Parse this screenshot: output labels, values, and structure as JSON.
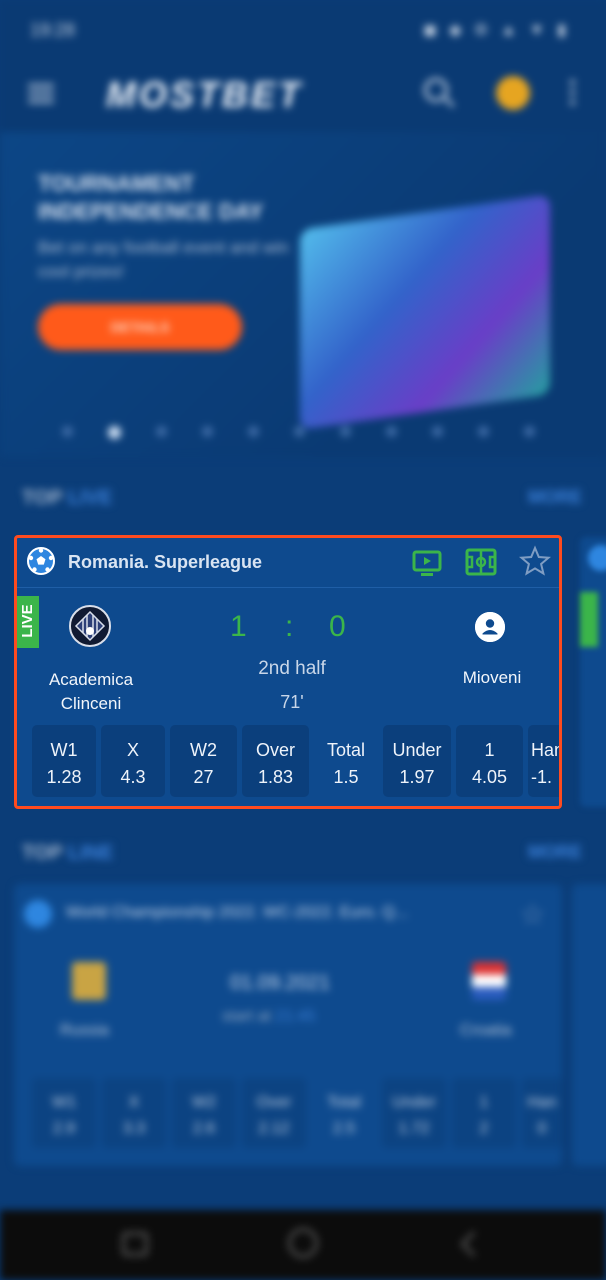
{
  "status_bar": {
    "time": "19:28",
    "icons": "◼ ◆ ⚙  ▲ ▼ ▮"
  },
  "app_bar": {
    "logo": "MOSTBET"
  },
  "banner": {
    "title": "TOURNAMENT INDEPENDENCE DAY",
    "subtitle": "Bet on any football event and win cool prizes!",
    "button": "DETAILS",
    "active_slide": 2,
    "slide_count": 11
  },
  "section1": {
    "title_a": "TOP",
    "title_b": "LIVE",
    "more": "MORE"
  },
  "section2": {
    "title_a": "TOP",
    "title_b": "LINE",
    "more": "MORE"
  },
  "match_card": {
    "league": "Romania. Superleague",
    "live_label": "LIVE",
    "team1": "Academica Clinceni",
    "team2": "Mioveni",
    "score1": "1",
    "score_sep": ":",
    "score2": "0",
    "period": "2nd half",
    "minute": "71'",
    "odds": [
      {
        "k": "W1",
        "v": "1.28"
      },
      {
        "k": "X",
        "v": "4.3"
      },
      {
        "k": "W2",
        "v": "27"
      },
      {
        "k": "Over",
        "v": "1.83"
      },
      {
        "k": "Total",
        "v": "1.5"
      },
      {
        "k": "Under",
        "v": "1.97"
      },
      {
        "k": "1",
        "v": "4.05"
      },
      {
        "k": "Han",
        "v": "-1."
      }
    ]
  },
  "line_card": {
    "league": "World Championship 2022. WC-2022. Euro. Q...",
    "team1": "Russia",
    "team2": "Croatia",
    "date": "01.09.2021",
    "start_label": "start at",
    "start_time": "21:45",
    "odds": [
      {
        "k": "W1",
        "v": "2.9"
      },
      {
        "k": "X",
        "v": "3.3"
      },
      {
        "k": "W2",
        "v": "2.6"
      },
      {
        "k": "Over",
        "v": "2.12"
      },
      {
        "k": "Total",
        "v": "2.5"
      },
      {
        "k": "Under",
        "v": "1.72"
      },
      {
        "k": "1",
        "v": "2"
      },
      {
        "k": "Han",
        "v": "0"
      }
    ]
  },
  "colors": {
    "accent": "#3bb54a",
    "highlight": "#ff4b1f",
    "bg": "#0b3d78",
    "card": "#0e4a8e"
  }
}
